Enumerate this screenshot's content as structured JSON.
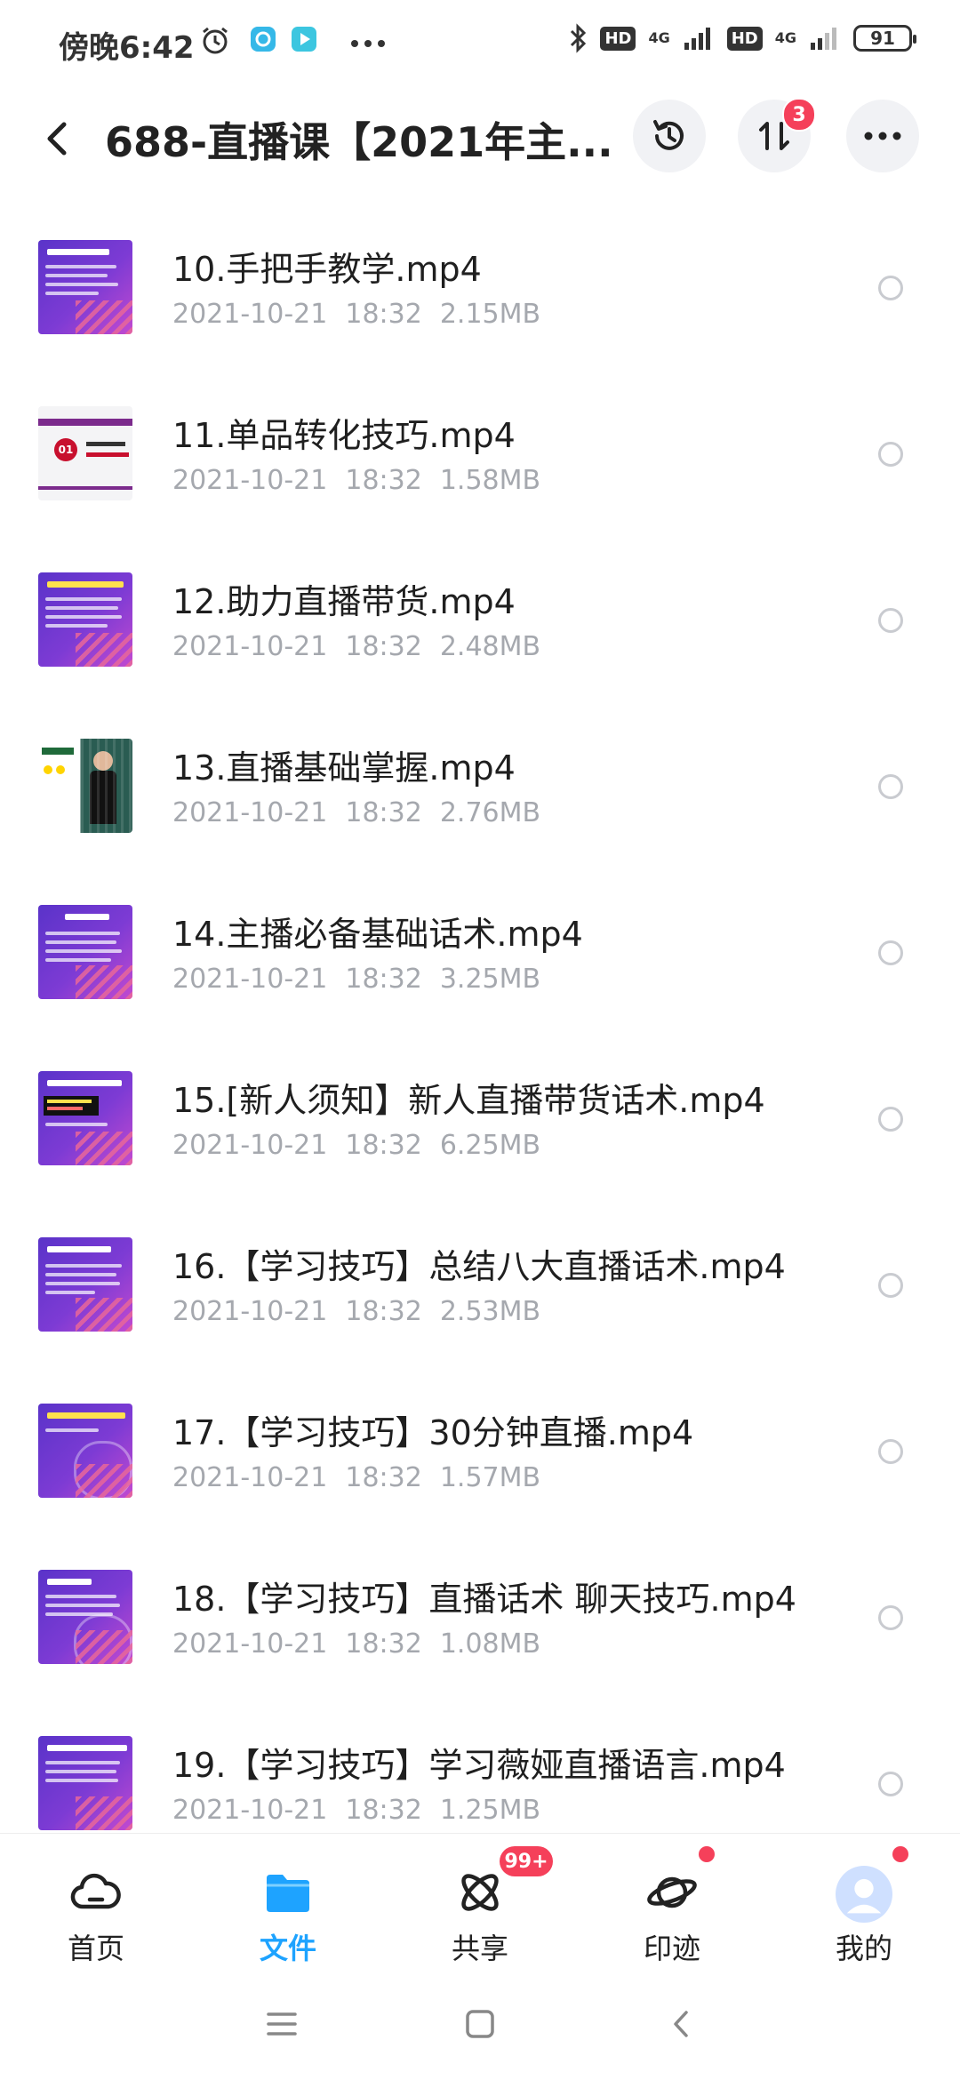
{
  "status": {
    "time": "傍晚6:42",
    "hd1": "HD",
    "hd2": "HD",
    "net1": "4G",
    "net2": "4G",
    "battery": "91"
  },
  "header": {
    "title": "688-直播课【2021年主...",
    "transfer_badge": "3"
  },
  "files": [
    {
      "name": "10.手把手教学.mp4",
      "date": "2021-10-21",
      "time": "18:32",
      "size": "2.15MB"
    },
    {
      "name": "11.单品转化技巧.mp4",
      "date": "2021-10-21",
      "time": "18:32",
      "size": "1.58MB"
    },
    {
      "name": "12.助力直播带货.mp4",
      "date": "2021-10-21",
      "time": "18:32",
      "size": "2.48MB"
    },
    {
      "name": "13.直播基础掌握.mp4",
      "date": "2021-10-21",
      "time": "18:32",
      "size": "2.76MB"
    },
    {
      "name": "14.主播必备基础话术.mp4",
      "date": "2021-10-21",
      "time": "18:32",
      "size": "3.25MB"
    },
    {
      "name": "15.[新人须知】新人直播带货话术.mp4",
      "date": "2021-10-21",
      "time": "18:32",
      "size": "6.25MB"
    },
    {
      "name": "16.【学习技巧】总结八大直播话术.mp4",
      "date": "2021-10-21",
      "time": "18:32",
      "size": "2.53MB"
    },
    {
      "name": "17.【学习技巧】30分钟直播.mp4",
      "date": "2021-10-21",
      "time": "18:32",
      "size": "1.57MB"
    },
    {
      "name": "18.【学习技巧】直播话术 聊天技巧.mp4",
      "date": "2021-10-21",
      "time": "18:32",
      "size": "1.08MB"
    },
    {
      "name": "19.【学习技巧】学习薇娅直播语言.mp4",
      "date": "2021-10-21",
      "time": "18:32",
      "size": "1.25MB"
    }
  ],
  "nav": {
    "home": "首页",
    "files": "文件",
    "share": "共享",
    "share_badge": "99+",
    "trace": "印迹",
    "me": "我的"
  },
  "colors": {
    "accent": "#1ea3ff",
    "badge": "#f5405a"
  }
}
